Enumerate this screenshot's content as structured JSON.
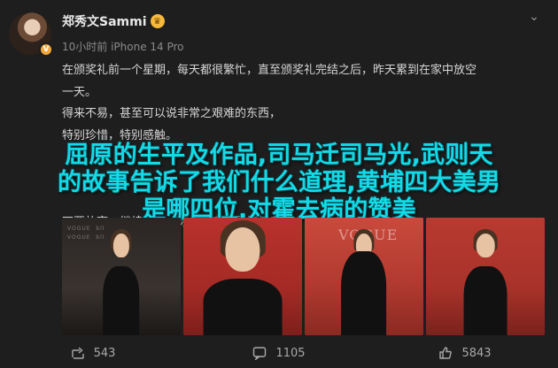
{
  "post": {
    "username": "郑秀文Sammi",
    "crown_icon": "crown-icon",
    "meta": "10小时前 iPhone 14 Pro",
    "lines": [
      "在颁奖礼前一个星期，每天都很繁忙，直至颁奖礼完结之后，昨天累到在家中放空",
      "一天。",
      "得来不易，甚至可以说非常之艰难的东西，",
      "特别珍惜，特别感触。",
      "",
      "",
      "",
      "不要放弃，继续努力，你们都交出最好的自己。"
    ],
    "overlay_lines": [
      "屈原的生平及作品,司马迁司马光,武则天",
      "的故事告诉了我们什么道理,黄埔四大美男",
      "是哪四位,对霍去病的赞美"
    ],
    "photos": [
      {
        "name": "photo-1",
        "wall": "VOGUE  bll\nVOGUE  bll",
        "vogue": ""
      },
      {
        "name": "photo-2",
        "wall": "",
        "vogue": ""
      },
      {
        "name": "photo-3",
        "wall": "",
        "vogue": "VOGUE"
      },
      {
        "name": "photo-4",
        "wall": "",
        "vogue": ""
      }
    ],
    "actions": {
      "share_count": "543",
      "comment_count": "1105",
      "like_count": "5843"
    }
  },
  "colors": {
    "background": "#1e1e1e",
    "overlay_text": "#14d9e6",
    "verified_badge": "#f2a93b"
  }
}
